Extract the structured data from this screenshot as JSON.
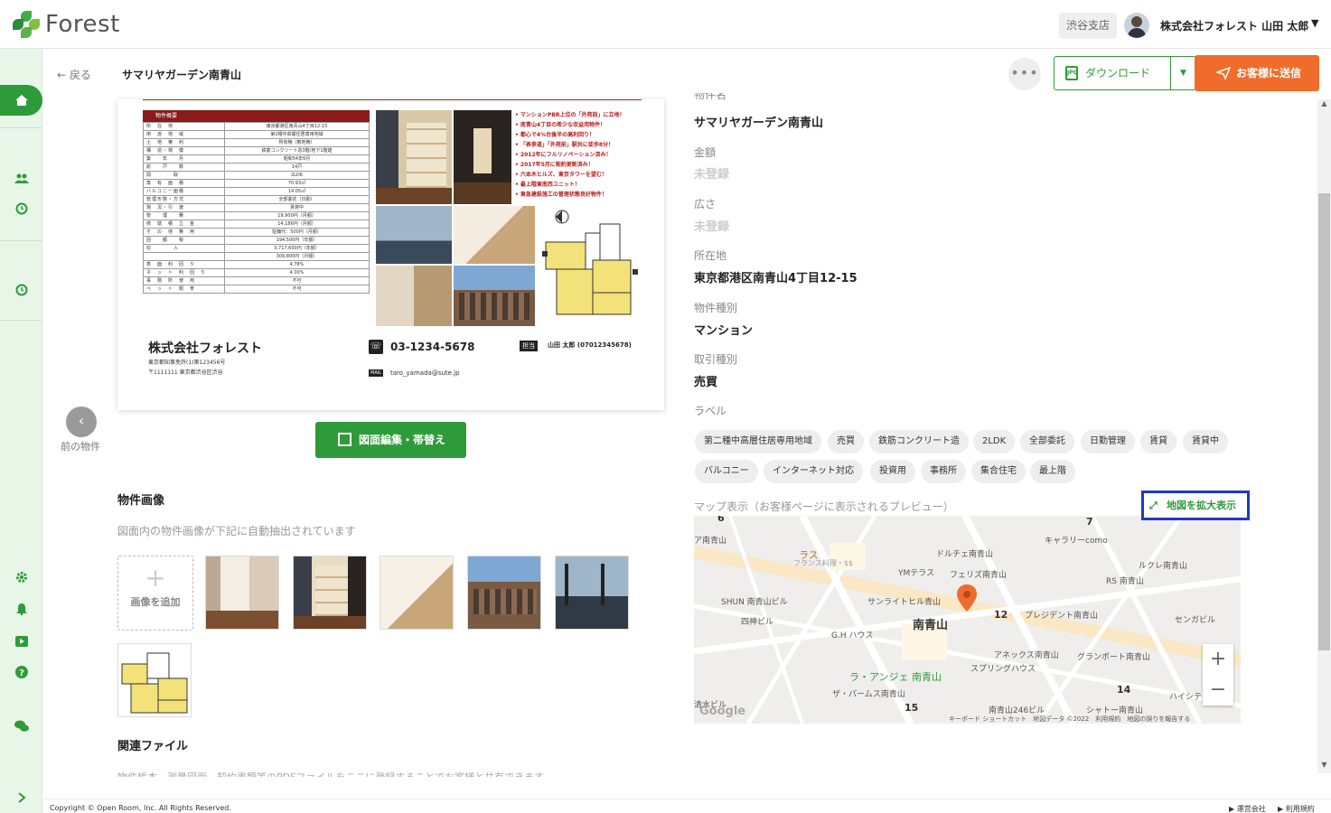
{
  "app": {
    "logo_text": "Forest"
  },
  "header": {
    "branch": "渋谷支店",
    "user_name": "株式会社フォレスト 山田 太郎",
    "caret": "▼"
  },
  "subbar": {
    "back_label": "戻る",
    "title": "サマリヤガーデン南青山",
    "more_label": "•••",
    "download_label": "ダウンロード",
    "download_icon_text": "JPG",
    "send_label": "お客様に送信"
  },
  "flyer": {
    "spec_title": "物件概要",
    "specs": [
      {
        "k": "所　在　地",
        "v": "東京都港区南青山4丁目12-15"
      },
      {
        "k": "用　途　地　域",
        "v": "第2種中高層住居専用地域"
      },
      {
        "k": "土　地　権　利",
        "v": "所有権（敷地権）"
      },
      {
        "k": "構　造・規　模",
        "v": "鉄筋コンクリート造3階/地下1階建"
      },
      {
        "k": "築　　年　　月",
        "v": "昭和54年6月"
      },
      {
        "k": "総　　戸　　数",
        "v": "14戸"
      },
      {
        "k": "間　　　　取",
        "v": "2LDK"
      },
      {
        "k": "専　有　面　積",
        "v": "70.93㎡"
      },
      {
        "k": "バルコニー面積",
        "v": "14.05㎡"
      },
      {
        "k": "管理形態・方式",
        "v": "全部委託（日勤）"
      },
      {
        "k": "現　況・引　渡",
        "v": "賃貸中"
      },
      {
        "k": "管　　理　　費",
        "v": "19,900円（月額）"
      },
      {
        "k": "修　繕　積　立　金",
        "v": "14,186円（月額）"
      },
      {
        "k": "そ　の　他　費　用",
        "v": "駐輪代：500円（月額）"
      },
      {
        "k": "固　　都　　税",
        "v": "194,500円（年額）"
      },
      {
        "k": "収　　　　入",
        "v": "3,717,600円（年額）"
      },
      {
        "k": "",
        "v": "309,800円（月額）"
      },
      {
        "k": "表　面　利　回　り",
        "v": "4.78%"
      },
      {
        "k": "ネ　ッ　ト　利　回　り",
        "v": "4.00%"
      },
      {
        "k": "事　務　所　使　用",
        "v": "不可"
      },
      {
        "k": "ペ　ッ　ト　飼　育",
        "v": "不可"
      }
    ],
    "bullets": [
      "• マンションPBR上位の「外苑前」に立地！",
      "• 南青山4丁目の希少な収益用物件！",
      "• 都心で4%台後半の高利回り！",
      "• 「表参道」「外苑前」駅共に徒歩8分！",
      "• 2012年にフルリノベーション済み！",
      "• 2017年5月に契約更新済み！",
      "• 六本木ヒルズ、東京タワーを望む！",
      "• 最上階東南西ユニット！",
      "• 東急建設施工の管理状態良好物件！"
    ],
    "company": "株式会社フォレスト",
    "license": "東京都知事免許(1)第123456号",
    "address": "〒1111111 東京都渋谷区渋谷",
    "phone": "03-1234-5678",
    "tanto_tag": "担当",
    "tanto": "山田 太郎 (07012345678)",
    "mail_tag": "MAIL",
    "mail": "taro_yamada@sute.jp"
  },
  "nav": {
    "prev_label": "前の物件",
    "prev_icon": "‹",
    "edit_button": "図面編集・帯替え"
  },
  "images_section": {
    "title": "物件画像",
    "desc": "図面内の物件画像が下記に自動抽出されています",
    "add_plus": "+",
    "add_label": "画像を追加"
  },
  "files_section": {
    "title": "関連ファイル",
    "desc": "物件帳本、測量図面、契約書類等のPDFファイルをここに登録することでお客様と共有できます"
  },
  "details": {
    "name_label": "物件名",
    "name": "サマリヤガーデン南青山",
    "price_label": "金額",
    "price": "未登録",
    "area_label": "広さ",
    "area": "未登録",
    "address_label": "所在地",
    "address": "東京都港区南青山4丁目12-15",
    "type_label": "物件種別",
    "type": "マンション",
    "trade_label": "取引種別",
    "trade": "売買",
    "labels_label": "ラベル",
    "labels": [
      "第二種中高層住居専用地域",
      "売買",
      "鉄筋コンクリート造",
      "2LDK",
      "全部委託",
      "日勤管理",
      "賃貸",
      "賃貸中",
      "バルコニー",
      "インターネット対応",
      "投資用",
      "事務所",
      "集合住宅",
      "最上階"
    ]
  },
  "map": {
    "label": "マップ表示（お客様ページに表示されるプレビュー）",
    "expand_label": "地図を拡大表示",
    "expand_icon": "⤢",
    "place_labels": [
      "南青山",
      "12",
      "ラ・アンジェ 南青山",
      "アネックス南青山",
      "プレジデント南青山",
      "スプリングハウス",
      "ザ・パームス南青山",
      "フェリズ南青山",
      "YMテラス",
      "サンライトヒル青山",
      "G.H ハウス",
      "SHUN 南青山ビル",
      "四神ビル",
      "ドルチェ南青山",
      "キャラリーcomo",
      "ルクレ南青山",
      "RS 南青山",
      "グランポート南青山",
      "センガビル",
      "ハイシティ",
      "南青山246ビル",
      "シャトー南青山",
      "清水ビル",
      "ラス",
      "フランス料理・$$",
      "ア南青山",
      "15",
      "14",
      "7",
      "6"
    ],
    "zoom_in": "+",
    "zoom_out": "−",
    "google": "Google",
    "credit": "キーボード ショートカット　地図データ ©2022　利用規約　地図の誤りを報告する"
  },
  "footer": {
    "copyright": "Copyright © Open Room, Inc. All Rights Reserved.",
    "link1": "▶ 運営会社",
    "link2": "▶ 利用規約"
  },
  "sidebar": {
    "icons": [
      "home-icon",
      "users-icon",
      "history-icon",
      "history-icon-2",
      "gear-icon",
      "bell-icon",
      "video-icon",
      "help-icon",
      "chat-icon",
      "expand-icon"
    ]
  },
  "colors": {
    "brand": "#2f9a3a",
    "accent": "#ef6c2a",
    "highlight": "#2337c7"
  }
}
